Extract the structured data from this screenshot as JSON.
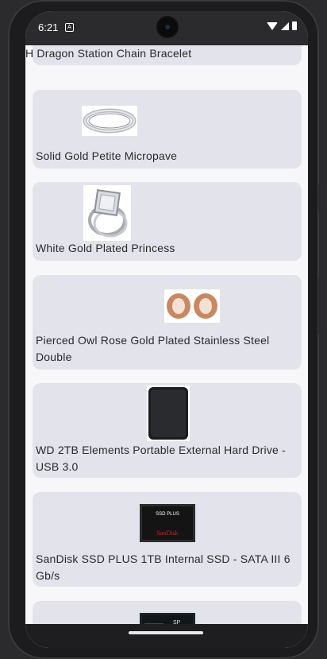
{
  "status": {
    "time": "6:21",
    "notification_icon": "A"
  },
  "products": [
    {
      "title": "Dragon Station Chain Bracelet",
      "prefix": "H",
      "image": "bracelet-image"
    },
    {
      "title": "Solid Gold Petite Micropave",
      "image": "silver-ring-image"
    },
    {
      "title": "White Gold Plated Princess",
      "image": "princess-ring-image"
    },
    {
      "title": "Pierced Owl Rose Gold Plated Stainless Steel Double",
      "image": "rose-gold-plugs-image"
    },
    {
      "title": "WD 2TB Elements Portable External Hard Drive - USB 3.0",
      "image": "hard-drive-image"
    },
    {
      "title": "SanDisk SSD PLUS 1TB Internal SSD - SATA III 6 Gb/s",
      "image": "sandisk-ssd-image",
      "image_text": {
        "line1": "SSD PLUS",
        "brand": "SanDisk"
      }
    },
    {
      "title": "",
      "image": "silicon-power-ssd-image",
      "image_text": {
        "brand": "SP"
      }
    }
  ]
}
